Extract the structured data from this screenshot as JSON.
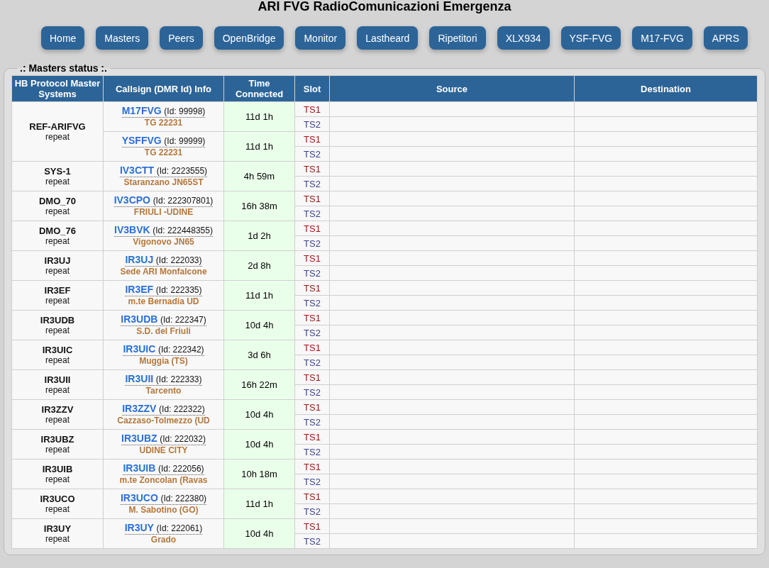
{
  "title": "ARI FVG RadioComunicazioni Emergenza",
  "nav": [
    "Home",
    "Masters",
    "Peers",
    "OpenBridge",
    "Monitor",
    "Lastheard",
    "Ripetitori",
    "XLX934",
    "YSF-FVG",
    "M17-FVG",
    "APRS"
  ],
  "panel": {
    "legend": ".: Masters status :.",
    "columns": [
      "HB Protocol Master Systems",
      "Callsign (DMR Id) Info",
      "Time Connected",
      "Slot",
      "Source",
      "Destination"
    ],
    "systems": [
      {
        "name": "REF-ARIFVG",
        "mode": "repeat",
        "peers": [
          {
            "callsign": "M17FVG",
            "id": "(Id: 99998)",
            "info": "TG 22231",
            "time": "11d 1h",
            "slots": [
              "TS1",
              "TS2"
            ]
          },
          {
            "callsign": "YSFFVG",
            "id": "(Id: 99999)",
            "info": "TG 22231",
            "time": "11d 1h",
            "slots": [
              "TS1",
              "TS2"
            ]
          }
        ]
      },
      {
        "name": "SYS-1",
        "mode": "repeat",
        "peers": [
          {
            "callsign": "IV3CTT",
            "id": "(Id: 2223555)",
            "info": "Staranzano JN65ST",
            "time": "4h 59m",
            "slots": [
              "TS1",
              "TS2"
            ]
          }
        ]
      },
      {
        "name": "DMO_70",
        "mode": "repeat",
        "peers": [
          {
            "callsign": "IV3CPO",
            "id": "(Id: 222307801)",
            "info": "FRIULI -UDINE",
            "time": "16h 38m",
            "slots": [
              "TS1",
              "TS2"
            ]
          }
        ]
      },
      {
        "name": "DMO_76",
        "mode": "repeat",
        "peers": [
          {
            "callsign": "IV3BVK",
            "id": "(Id: 222448355)",
            "info": "Vigonovo JN65",
            "time": "1d 2h",
            "slots": [
              "TS1",
              "TS2"
            ]
          }
        ]
      },
      {
        "name": "IR3UJ",
        "mode": "repeat",
        "peers": [
          {
            "callsign": "IR3UJ",
            "id": "(Id: 222033)",
            "info": "Sede ARI Monfalcone",
            "time": "2d 8h",
            "slots": [
              "TS1",
              "TS2"
            ]
          }
        ]
      },
      {
        "name": "IR3EF",
        "mode": "repeat",
        "peers": [
          {
            "callsign": "IR3EF",
            "id": "(Id: 222335)",
            "info": "m.te Bernadia UD",
            "time": "11d 1h",
            "slots": [
              "TS1",
              "TS2"
            ]
          }
        ]
      },
      {
        "name": "IR3UDB",
        "mode": "repeat",
        "peers": [
          {
            "callsign": "IR3UDB",
            "id": "(Id: 222347)",
            "info": "S.D. del Friuli",
            "time": "10d 4h",
            "slots": [
              "TS1",
              "TS2"
            ]
          }
        ]
      },
      {
        "name": "IR3UIC",
        "mode": "repeat",
        "peers": [
          {
            "callsign": "IR3UIC",
            "id": "(Id: 222342)",
            "info": "Muggia (TS)",
            "time": "3d 6h",
            "slots": [
              "TS1",
              "TS2"
            ]
          }
        ]
      },
      {
        "name": "IR3UII",
        "mode": "repeat",
        "peers": [
          {
            "callsign": "IR3UII",
            "id": "(Id: 222333)",
            "info": "Tarcento",
            "time": "16h 22m",
            "slots": [
              "TS1",
              "TS2"
            ]
          }
        ]
      },
      {
        "name": "IR3ZZV",
        "mode": "repeat",
        "peers": [
          {
            "callsign": "IR3ZZV",
            "id": "(Id: 222322)",
            "info": "Cazzaso-Tolmezzo (UD",
            "time": "10d 4h",
            "slots": [
              "TS1",
              "TS2"
            ]
          }
        ]
      },
      {
        "name": "IR3UBZ",
        "mode": "repeat",
        "peers": [
          {
            "callsign": "IR3UBZ",
            "id": "(Id: 222032)",
            "info": "UDINE CITY",
            "time": "10d 4h",
            "slots": [
              "TS1",
              "TS2"
            ]
          }
        ]
      },
      {
        "name": "IR3UIB",
        "mode": "repeat",
        "peers": [
          {
            "callsign": "IR3UIB",
            "id": "(Id: 222056)",
            "info": "m.te Zoncolan (Ravas",
            "time": "10h 18m",
            "slots": [
              "TS1",
              "TS2"
            ]
          }
        ]
      },
      {
        "name": "IR3UCO",
        "mode": "repeat",
        "peers": [
          {
            "callsign": "IR3UCO",
            "id": "(Id: 222380)",
            "info": "M. Sabotino (GO)",
            "time": "11d 1h",
            "slots": [
              "TS1",
              "TS2"
            ]
          }
        ]
      },
      {
        "name": "IR3UY",
        "mode": "repeat",
        "peers": [
          {
            "callsign": "IR3UY",
            "id": "(Id: 222061)",
            "info": "Grado",
            "time": "10d 4h",
            "slots": [
              "TS1",
              "TS2"
            ]
          }
        ]
      }
    ]
  }
}
